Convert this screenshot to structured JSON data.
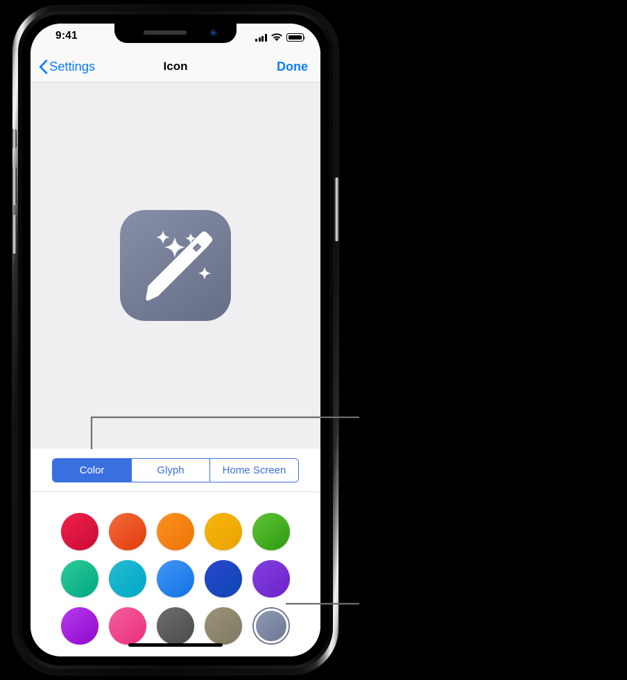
{
  "status_bar": {
    "time": "9:41",
    "signal_icon": "cellular-bars-icon",
    "wifi_icon": "wifi-icon",
    "battery_icon": "battery-full-icon"
  },
  "nav_bar": {
    "back_label": "Settings",
    "back_icon": "chevron-left-icon",
    "title": "Icon",
    "done_label": "Done",
    "tint_color": "#0A7CFF"
  },
  "preview": {
    "icon_name": "magic-wand-sparkles-icon",
    "background_color": "#EFEFF1",
    "icon_gradient_start": "#868EA8",
    "icon_gradient_end": "#656D87"
  },
  "segmented_control": {
    "selected_index": 0,
    "accent_color": "#3A6FE0",
    "segments": [
      {
        "label": "Color"
      },
      {
        "label": "Glyph"
      },
      {
        "label": "Home Screen"
      }
    ]
  },
  "color_grid": {
    "selected_index": 14,
    "rows": [
      [
        {
          "name": "crimson",
          "start": "#F0224B",
          "end": "#C80A33"
        },
        {
          "name": "red-orange",
          "start": "#F36B3C",
          "end": "#E23B0A"
        },
        {
          "name": "orange",
          "start": "#FA9120",
          "end": "#EE7407"
        },
        {
          "name": "amber",
          "start": "#F6B60C",
          "end": "#E9A200"
        },
        {
          "name": "green",
          "start": "#5FC336",
          "end": "#2E9B10"
        }
      ],
      [
        {
          "name": "teal-green",
          "start": "#2BCB97",
          "end": "#02A783"
        },
        {
          "name": "cyan",
          "start": "#25BBD2",
          "end": "#00A8C4"
        },
        {
          "name": "light-blue",
          "start": "#4296F5",
          "end": "#1272E6"
        },
        {
          "name": "deep-blue",
          "start": "#2A46CE",
          "end": "#0D46B4"
        },
        {
          "name": "purple",
          "start": "#8440E0",
          "end": "#6A22C9"
        }
      ],
      [
        {
          "name": "magenta",
          "start": "#B73CEB",
          "end": "#8E07CE"
        },
        {
          "name": "pink",
          "start": "#F4609C",
          "end": "#E92E7C"
        },
        {
          "name": "dark-gray",
          "start": "#6E6E6E",
          "end": "#4A4A4A"
        },
        {
          "name": "khaki",
          "start": "#9B9479",
          "end": "#7E7862"
        },
        {
          "name": "slate-blue",
          "start": "#8E99B4",
          "end": "#6D7894"
        }
      ]
    ]
  },
  "home_indicator": {
    "label": "home-indicator"
  },
  "callouts": [
    {
      "target": "segmented-control-color-segment"
    },
    {
      "target": "selected-color-swatch"
    }
  ]
}
